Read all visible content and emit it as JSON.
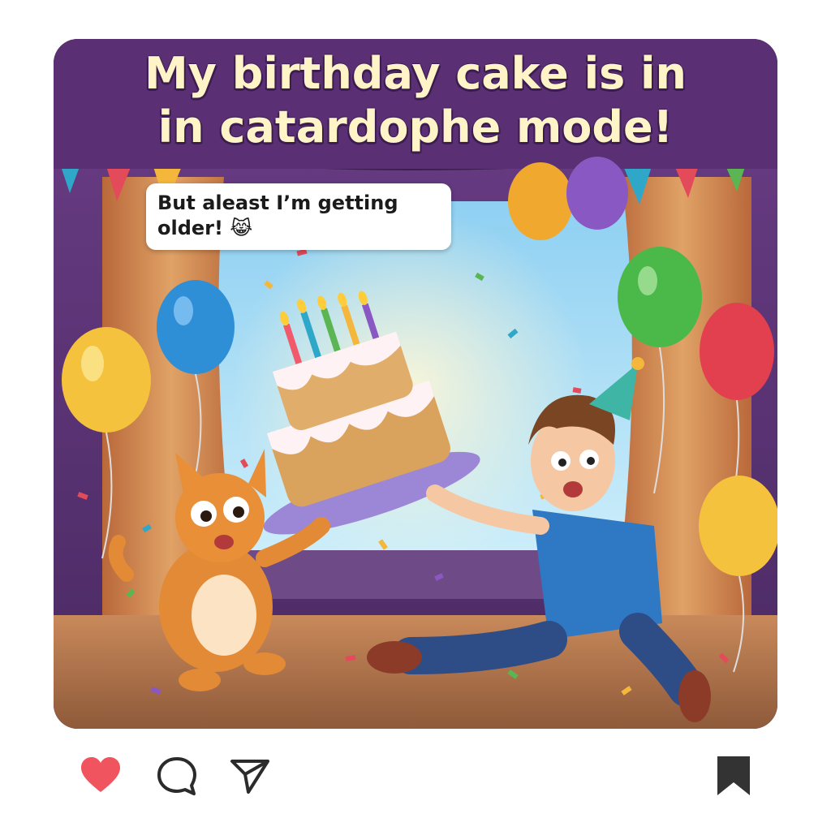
{
  "post": {
    "headline_line1": "My birthday cake is in",
    "headline_line2": "in catardophe mode!",
    "caption_line1": "But aleast I’m getting",
    "caption_line2": "older! 😹"
  },
  "actions": {
    "like_icon": "heart-icon",
    "comment_icon": "comment-icon",
    "share_icon": "send-icon",
    "save_icon": "bookmark-icon",
    "like_color": "#f0545f",
    "icon_color": "#2b2b2b"
  },
  "colors": {
    "banner_purple": "#5a2f73",
    "headline_text": "#fff4c8"
  }
}
